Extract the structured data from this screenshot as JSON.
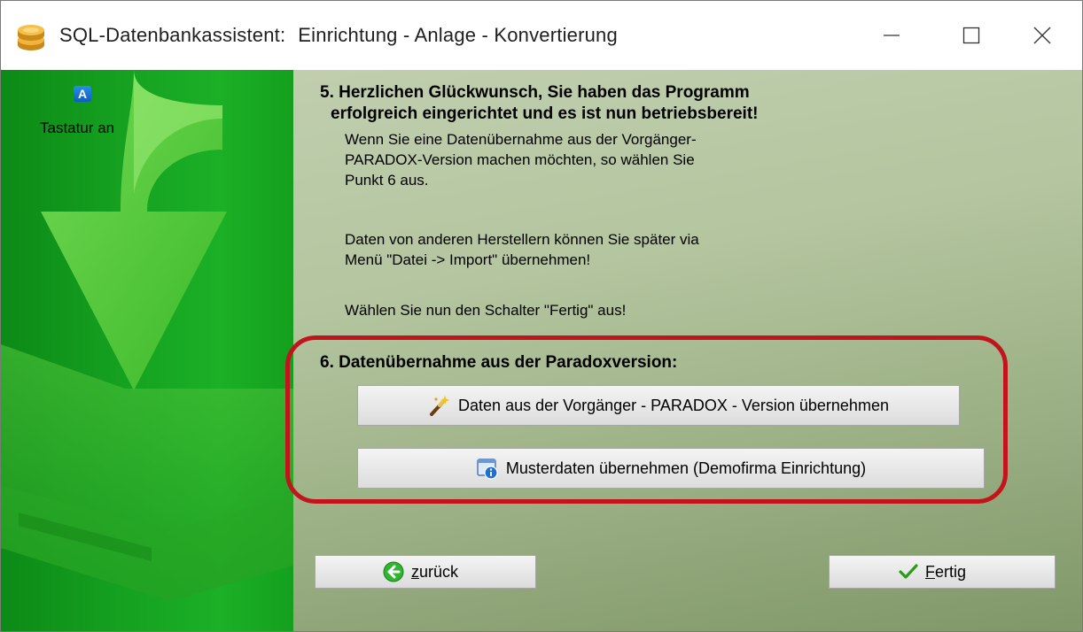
{
  "window": {
    "app_name": "SQL-Datenbankassistent:",
    "subtitle": "Einrichtung - Anlage - Konvertierung"
  },
  "sidebar": {
    "keyboard_icon_letter": "A",
    "keyboard_label": "Tastatur an"
  },
  "step5": {
    "heading_line1": "5. Herzlichen Glückwunsch, Sie haben das Programm",
    "heading_line2": "erfolgreich eingerichtet und es ist nun betriebsbereit!",
    "para1_line1": "Wenn Sie eine Datenübernahme aus der Vorgänger-",
    "para1_line2": "PARADOX-Version machen möchten, so wählen Sie",
    "para1_line3": "Punkt 6 aus.",
    "para2_line1": "Daten von anderen Herstellern können Sie später via",
    "para2_line2": "Menü \"Datei -> Import\" übernehmen!",
    "para3": "Wählen Sie nun den Schalter \"Fertig\" aus!"
  },
  "step6": {
    "heading": "6. Datenübernahme aus der Paradoxversion:",
    "import_button": "Daten aus der Vorgänger - PARADOX - Version übernehmen",
    "sample_button": "Musterdaten übernehmen (Demofirma Einrichtung)"
  },
  "nav": {
    "back_mnemonic": "z",
    "back_rest": "urück",
    "finish_mnemonic": "F",
    "finish_rest": "ertig"
  },
  "colors": {
    "highlight": "#c1141c",
    "sidebar_green": "#1bb026"
  },
  "icons": {
    "app": "coins-database-icon",
    "keyboard": "keyboard-a-icon",
    "import": "magic-wand-icon",
    "sample": "info-window-icon",
    "back": "green-back-arrow-icon",
    "finish": "checkmark-icon"
  }
}
